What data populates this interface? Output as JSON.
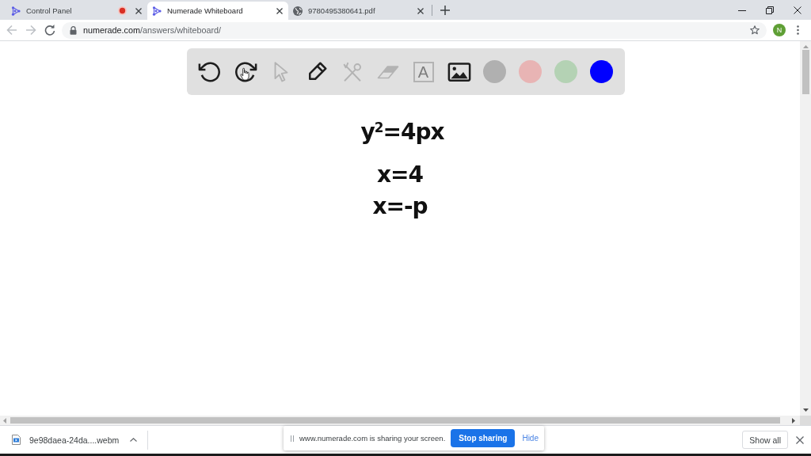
{
  "tabs": [
    {
      "kind": "app",
      "title": "Control Panel",
      "selected": false,
      "recording": true
    },
    {
      "kind": "app",
      "title": "Numerade Whiteboard",
      "selected": true,
      "recording": false
    },
    {
      "kind": "web",
      "title": "9780495380641.pdf",
      "selected": false,
      "recording": false
    }
  ],
  "toolbar": {
    "nav": [
      {
        "kind": "back",
        "disabled": true
      },
      {
        "kind": "forward",
        "disabled": true
      },
      {
        "kind": "reload",
        "disabled": false
      }
    ],
    "url": {
      "host": "numerade.com",
      "path": "/answers/whiteboard/"
    },
    "profile": "N"
  },
  "whiteboard": {
    "tools": [
      {
        "kind": "undo",
        "disabled": false,
        "hovered": false
      },
      {
        "kind": "redo",
        "disabled": false,
        "hovered": true
      },
      {
        "kind": "select",
        "disabled": true,
        "hovered": false
      },
      {
        "kind": "pen",
        "disabled": false,
        "hovered": false
      },
      {
        "kind": "shapes",
        "disabled": true,
        "hovered": false
      },
      {
        "kind": "eraser",
        "disabled": true,
        "hovered": false
      },
      {
        "kind": "text",
        "disabled": true,
        "hovered": false,
        "glyph": "A"
      },
      {
        "kind": "image",
        "disabled": false,
        "hovered": false
      }
    ],
    "colors": [
      {
        "color": "#b0b0b0"
      },
      {
        "color": "#e8b4b4"
      },
      {
        "color": "#b4d2b4"
      },
      {
        "color": "#0000ff"
      }
    ],
    "lines": [
      "y$^{2}$=4px",
      "x=4",
      "x=-p"
    ]
  },
  "download_bar": {
    "file": "9e98daea-24da....webm",
    "show_all": "Show all"
  },
  "share_notice": {
    "message": "www.numerade.com is sharing your screen.",
    "stop_button": "Stop sharing",
    "hide_link": "Hide"
  }
}
